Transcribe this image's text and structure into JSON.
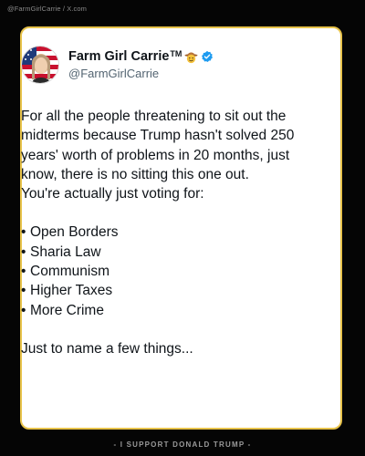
{
  "watermark": "@FarmGirlCarrie / X.com",
  "post": {
    "display_name": "Farm Girl Carrie",
    "tm": "TM",
    "handle": "@FarmGirlCarrie",
    "avatar_icon": "profile-photo-flag-background",
    "emoji_icon": "cowboy-hat-face-emoji",
    "badge_icon": "verified-badge-icon",
    "paragraph_1": [
      "For all the people threatening to sit out the",
      "midterms because Trump hasn't solved 250",
      "years' worth of problems in 20 months, just",
      "know, there is no sitting this one out.",
      "You're actually just voting for:"
    ],
    "bullets": [
      "Open Borders",
      "Sharia Law",
      "Communism",
      "Higher Taxes",
      "More Crime"
    ],
    "closing": "Just to name a few things..."
  },
  "footer": "- I SUPPORT DONALD TRUMP -",
  "colors": {
    "border": "#e8c34a",
    "verified": "#1d9bf0",
    "text": "#0f1419",
    "handle": "#536471"
  }
}
